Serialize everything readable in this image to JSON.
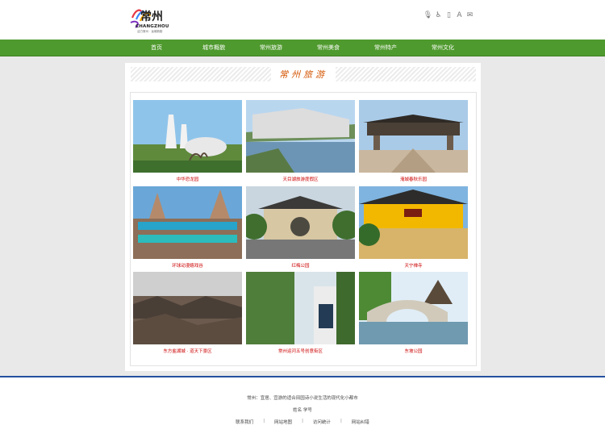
{
  "header": {
    "logo_cn": "常州",
    "logo_en": "CHANGZHOU",
    "logo_sub": "活力常州 · 龙城新韵",
    "tools": [
      "microphone-icon",
      "accessibility-icon",
      "mobile-icon",
      "font-size-icon",
      "mail-icon"
    ],
    "tool_glyphs": [
      "🎙",
      "♿",
      "▯",
      "A",
      "✉"
    ]
  },
  "nav": {
    "items": [
      "首页",
      "城市概貌",
      "常州旅游",
      "常州美食",
      "常州特产",
      "常州文化"
    ]
  },
  "section": {
    "title": "常州旅游"
  },
  "gallery": [
    {
      "caption": "中华恐龙园"
    },
    {
      "caption": "天目湖旅游度假区"
    },
    {
      "caption": "淹城春秋乐园"
    },
    {
      "caption": "环球动漫嬉戏谷"
    },
    {
      "caption": "红梅公园"
    },
    {
      "caption": "天宁禅寺"
    },
    {
      "caption": "东方盐湖城 · 道天下景区"
    },
    {
      "caption": "常州运河五号创意街区"
    },
    {
      "caption": "东坡公园"
    }
  ],
  "footer": {
    "line1": "常州：宜居、宜游的适合田园诗小说生活的现代化小都市",
    "line2": "姓名  学号",
    "links": [
      "联系我们",
      "网站地图",
      "访问统计",
      "网站纠错"
    ],
    "separator": "|"
  },
  "colors": {
    "nav_green": "#4f9a2e",
    "title_orange": "#d35400",
    "caption_red": "#cc0000",
    "footer_blue": "#2550a0"
  }
}
